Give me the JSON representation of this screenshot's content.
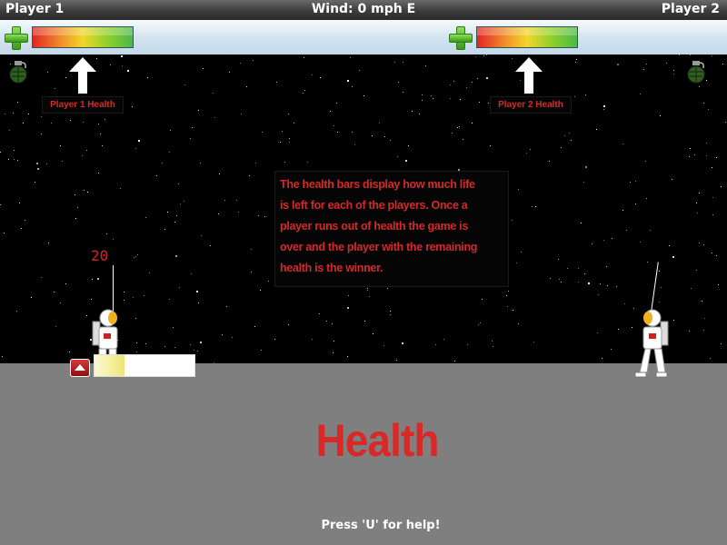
{
  "topbar": {
    "player1": "Player 1",
    "wind": "Wind: 0 mph E",
    "player2": "Player 2"
  },
  "hud": {
    "health_icon": "plus-icon",
    "weapon_icon": "grenade-icon"
  },
  "callouts": {
    "p1_health_label": "Player 1 Health",
    "p2_health_label": "Player 2 Health",
    "info_line1": "The health bars display how much life",
    "info_line2": "is left for each of the players. Once a",
    "info_line3": "player runs out of health the game is",
    "info_line4": "over and the player with the remaining",
    "info_line5": "health is the winner."
  },
  "player1": {
    "angle": "20",
    "power_fraction": 0.3
  },
  "ground": {
    "title": "Health",
    "help": "Press 'U' for help!"
  },
  "colors": {
    "accent_red": "#d82828",
    "ground": "#7f7f7f",
    "hud_bar": "#d4e4f0"
  }
}
